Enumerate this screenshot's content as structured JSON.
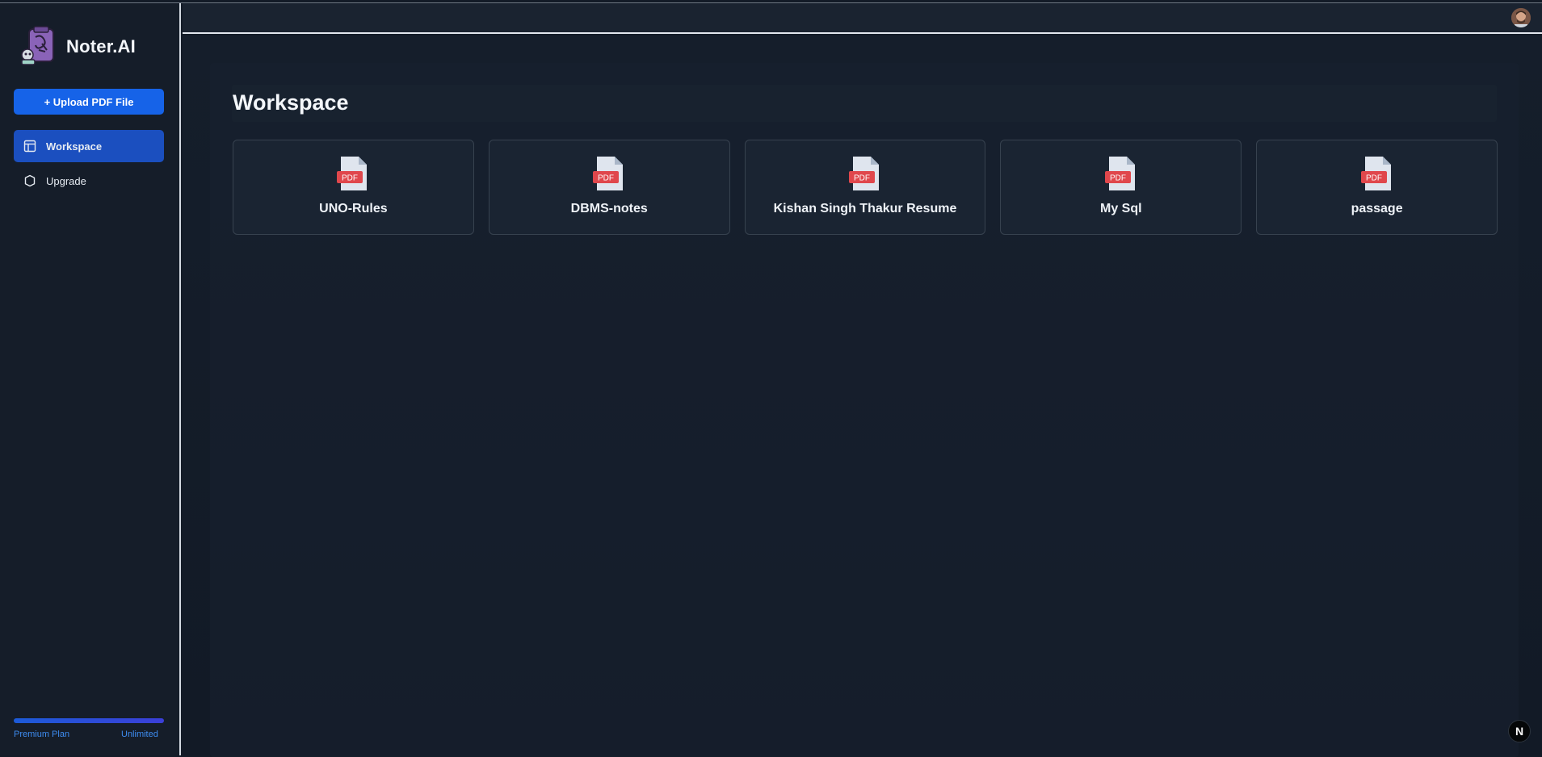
{
  "app": {
    "name": "Noter.AI"
  },
  "sidebar": {
    "upload_label": "+ Upload PDF File",
    "items": [
      {
        "label": "Workspace",
        "icon": "layout-icon",
        "active": true
      },
      {
        "label": "Upgrade",
        "icon": "shield-icon",
        "active": false
      }
    ],
    "plan": {
      "name": "Premium Plan",
      "limit": "Unlimited",
      "progress": 1.0
    }
  },
  "main": {
    "title": "Workspace",
    "files": [
      {
        "name": "UNO-Rules",
        "icon": "pdf-file-icon",
        "badge": "PDF"
      },
      {
        "name": "DBMS-notes",
        "icon": "pdf-file-icon",
        "badge": "PDF"
      },
      {
        "name": "Kishan Singh Thakur Resume",
        "icon": "pdf-file-icon",
        "badge": "PDF"
      },
      {
        "name": "My Sql",
        "icon": "pdf-file-icon",
        "badge": "PDF"
      },
      {
        "name": "passage",
        "icon": "pdf-file-icon",
        "badge": "PDF"
      }
    ]
  },
  "dev_badge": {
    "label": "N"
  },
  "colors": {
    "accent": "#1663e8",
    "active_nav": "#1b4fbf",
    "plan_text": "#3d8cf0",
    "pdf_badge": "#e0474c"
  }
}
